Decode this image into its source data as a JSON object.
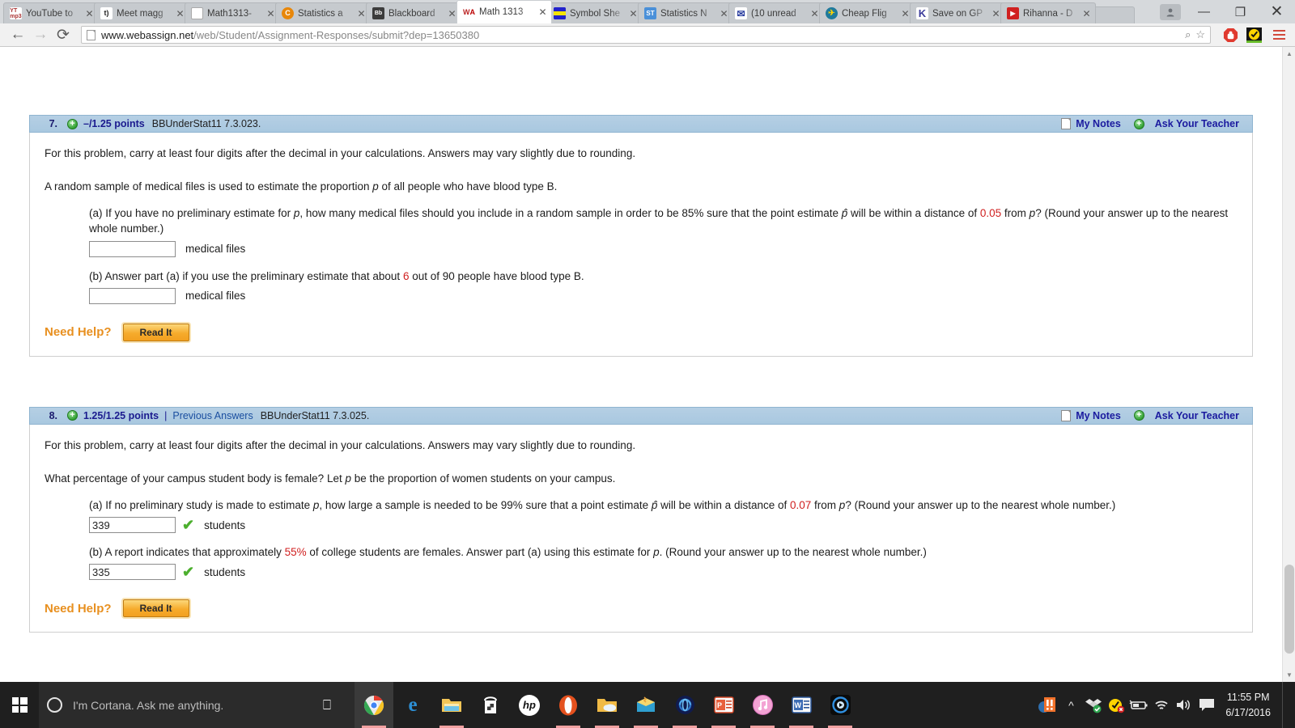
{
  "browser": {
    "tabs": [
      {
        "title": "YouTube to",
        "favicon": "youtube-mp3-icon",
        "active": false
      },
      {
        "title": "Meet magg",
        "favicon": "meetme-icon",
        "active": false
      },
      {
        "title": "Math1313-",
        "favicon": "document-icon",
        "active": false
      },
      {
        "title": "Statistics a",
        "favicon": "chegg-icon",
        "active": false
      },
      {
        "title": "Blackboard",
        "favicon": "blackboard-icon",
        "active": false
      },
      {
        "title": "Math 1313",
        "favicon": "webassign-icon",
        "active": true
      },
      {
        "title": "Symbol She",
        "favicon": "symbol-sheet-icon",
        "active": false
      },
      {
        "title": "Statistics N",
        "favicon": "slader-icon",
        "active": false
      },
      {
        "title": "(10 unread",
        "favicon": "mail-icon",
        "active": false
      },
      {
        "title": "Cheap Flig",
        "favicon": "flight-icon",
        "active": false
      },
      {
        "title": "Save on GP",
        "favicon": "kayak-icon",
        "active": false
      },
      {
        "title": "Rihanna - D",
        "favicon": "youtube-icon",
        "active": false
      }
    ],
    "window_controls": {
      "minimize": "—",
      "maximize": "❐",
      "close": "✕"
    },
    "nav": {
      "back": "←",
      "forward": "→",
      "reload": "⟳"
    },
    "url": {
      "domain": "www.webassign.net",
      "path": "/web/Student/Assignment-Responses/submit?dep=13650380"
    },
    "omnibox_icons": [
      "zoom-icon",
      "bookmark-star-icon"
    ],
    "extensions": [
      "adblock-icon",
      "norton-safe-web-icon"
    ],
    "menu": "chrome-menu-icon"
  },
  "questions": [
    {
      "number": "7.",
      "points": "–/1.25 points",
      "previous_answers": null,
      "code": "BBUnderStat11 7.3.023.",
      "my_notes": "My Notes",
      "ask_teacher": "Ask Your Teacher",
      "intro": "For this problem, carry at least four digits after the decimal in your calculations. Answers may vary slightly due to rounding.",
      "stem_pre": "A random sample of medical files is used to estimate the proportion ",
      "stem_var": "p",
      "stem_post": " of all people who have blood type B.",
      "parts": [
        {
          "label": "(a)",
          "text_1": "If you have no preliminary estimate for ",
          "var_1": "p",
          "text_2": ", how many medical files should you include in a random sample in order to be 85% sure that the point estimate ",
          "var_2": "p̂",
          "text_3": " will be within a distance of ",
          "highlight": "0.05",
          "text_4": " from ",
          "var_3": "p",
          "text_5": "? (Round your answer up to the nearest whole number.)",
          "value": "",
          "correct": false,
          "unit": "medical files"
        },
        {
          "label": "(b)",
          "text_1": "Answer part (a) if you use the preliminary estimate that about ",
          "highlight": "6",
          "text_2": " out of 90 people have blood type B.",
          "value": "",
          "correct": false,
          "unit": "medical files"
        }
      ],
      "need_help": "Need Help?",
      "read_it": "Read It"
    },
    {
      "number": "8.",
      "points": "1.25/1.25 points",
      "previous_answers": "Previous Answers",
      "code": "BBUnderStat11 7.3.025.",
      "my_notes": "My Notes",
      "ask_teacher": "Ask Your Teacher",
      "intro": "For this problem, carry at least four digits after the decimal in your calculations. Answers may vary slightly due to rounding.",
      "stem_pre": "What percentage of your campus student body is female? Let ",
      "stem_var": "p",
      "stem_post": " be the proportion of women students on your campus.",
      "parts": [
        {
          "label": "(a)",
          "text_1": "If no preliminary study is made to estimate ",
          "var_1": "p",
          "text_2": ", how large a sample is needed to be 99% sure that a point estimate ",
          "var_2": "p̂",
          "text_3": " will be within a distance of ",
          "highlight": "0.07",
          "text_4": " from ",
          "var_3": "p",
          "text_5": "? (Round your answer up to the nearest whole number.)",
          "value": "339",
          "correct": true,
          "unit": "students"
        },
        {
          "label": "(b)",
          "text_1": "A report indicates that approximately ",
          "highlight": "55%",
          "text_2": " of college students are females. Answer part (a) using this estimate for ",
          "var_1": "p",
          "text_3": ". (Round your answer up to the nearest whole number.)",
          "value": "335",
          "correct": true,
          "unit": "students"
        }
      ],
      "need_help": "Need Help?",
      "read_it": "Read It"
    }
  ],
  "taskbar": {
    "start": "windows-start-icon",
    "cortana_placeholder": "I'm Cortana. Ask me anything.",
    "task_view": "task-view-icon",
    "pinned_apps": [
      "chrome-icon",
      "edge-icon",
      "file-explorer-icon",
      "windows-store-icon",
      "hp-icon",
      "opera-icon",
      "folder-cloud-icon",
      "winzip-icon",
      "support-assistant-icon",
      "powerpoint-icon",
      "itunes-icon",
      "word-icon",
      "media-player-icon"
    ],
    "tray_icons": [
      "mcafee-icon",
      "show-hidden-icon",
      "dropbox-icon",
      "norton-icon",
      "battery-icon",
      "wifi-icon",
      "volume-icon",
      "action-center-icon"
    ],
    "clock_time": "11:55 PM",
    "clock_date": "6/17/2016"
  },
  "colors": {
    "header_blue": "#a9c8e0",
    "link_blue": "#1b1b9f",
    "highlight_red": "#d02020",
    "check_green": "#4caf2e",
    "need_help_orange": "#e89020",
    "taskbar_dark": "#1f1f1f"
  }
}
